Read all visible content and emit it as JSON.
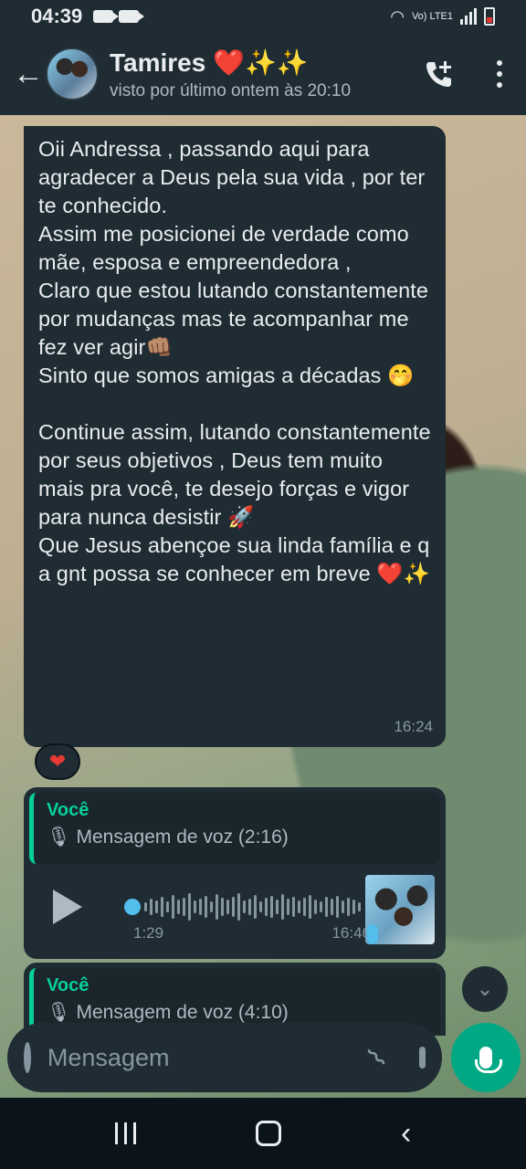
{
  "status_bar": {
    "time": "04:39",
    "network": "Vo) LTE1"
  },
  "header": {
    "name": "Tamires ❤️✨✨",
    "last_seen": "visto por último ontem às 20:10"
  },
  "messages": [
    {
      "text": "Oii Andressa , passando aqui para agradecer a Deus pela sua vida , por ter te conhecido.\nAssim me posicionei de verdade como mãe, esposa e empreendedora ,\nClaro que estou lutando constantemente por mudanças mas te acompanhar me fez ver agir👊🏽\nSinto que somos amigas a décadas 🤭\n\nContinue assim, lutando constantemente por seus objetivos , Deus tem muito mais pra você, te desejo forças e vigor para nunca desistir 🚀\nQue Jesus abençoe sua linda família e q a gnt possa se conhecer em breve ❤️✨",
      "time": "16:24",
      "reaction": "❤"
    },
    {
      "quote_author": "Você",
      "quote_text": "🎙 Mensagem de voz (2:16)",
      "voice_duration": "1:29",
      "time": "16:46",
      "progress": 0.0
    },
    {
      "quote_author": "Você",
      "quote_text": "🎙 Mensagem de voz (4:10)"
    }
  ],
  "composer": {
    "placeholder": "Mensagem"
  },
  "icons": {
    "back": "arrow-left-icon",
    "call": "add-call-icon",
    "menu": "more-vert-icon",
    "emoji": "emoji-icon",
    "attach": "paperclip-icon",
    "camera": "camera-icon",
    "mic": "mic-icon"
  },
  "colors": {
    "accent": "#00a884",
    "quote_accent": "#06cf9c",
    "bubble": "#1f2c34",
    "link_blue": "#53bdeb"
  }
}
